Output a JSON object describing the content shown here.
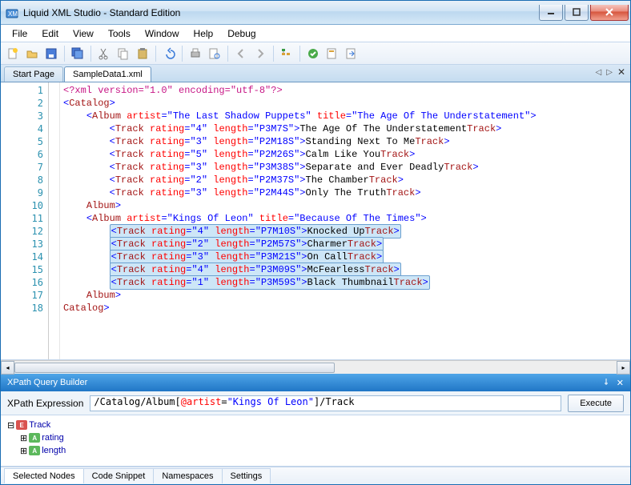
{
  "window": {
    "title": "Liquid XML Studio - Standard Edition"
  },
  "menu": {
    "file": "File",
    "edit": "Edit",
    "view": "View",
    "tools": "Tools",
    "window": "Window",
    "help": "Help",
    "debug": "Debug"
  },
  "tabs": {
    "start": "Start Page",
    "file": "SampleData1.xml"
  },
  "lines": {
    "n1": "1",
    "n2": "2",
    "n3": "3",
    "n4": "4",
    "n5": "5",
    "n6": "6",
    "n7": "7",
    "n8": "8",
    "n9": "9",
    "n10": "10",
    "n11": "11",
    "n12": "12",
    "n13": "13",
    "n14": "14",
    "n15": "15",
    "n16": "16",
    "n17": "17",
    "n18": "18"
  },
  "xml": {
    "decl": "<?xml version=\"1.0\" encoding=\"utf-8\"?>",
    "catalog_open": "Catalog",
    "catalog_close": "Catalog",
    "album1": {
      "tag": "Album",
      "close": "Album",
      "artist_k": "artist",
      "artist_v": "\"The Last Shadow Puppets\"",
      "title_k": "title",
      "title_v": "\"The Age Of The Understatement\"",
      "tracks": [
        {
          "rating": "\"4\"",
          "length": "\"P3M7S\"",
          "text": "The Age Of The Understatement"
        },
        {
          "rating": "\"3\"",
          "length": "\"P2M18S\"",
          "text": "Standing Next To Me"
        },
        {
          "rating": "\"5\"",
          "length": "\"P2M26S\"",
          "text": "Calm Like You"
        },
        {
          "rating": "\"3\"",
          "length": "\"P3M38S\"",
          "text": "Separate and Ever Deadly"
        },
        {
          "rating": "\"2\"",
          "length": "\"P2M37S\"",
          "text": "The Chamber"
        },
        {
          "rating": "\"3\"",
          "length": "\"P2M44S\"",
          "text": "Only The Truth"
        }
      ]
    },
    "album2": {
      "tag": "Album",
      "close": "Album",
      "artist_k": "artist",
      "artist_v": "\"Kings Of Leon\"",
      "title_k": "title",
      "title_v": "\"Because Of The Times\"",
      "tracks": [
        {
          "rating": "\"4\"",
          "length": "\"P7M10S\"",
          "text": "Knocked Up"
        },
        {
          "rating": "\"2\"",
          "length": "\"P2M57S\"",
          "text": "Charmer"
        },
        {
          "rating": "\"3\"",
          "length": "\"P3M21S\"",
          "text": "On Call"
        },
        {
          "rating": "\"4\"",
          "length": "\"P3M09S\"",
          "text": "McFearless"
        },
        {
          "rating": "\"1\"",
          "length": "\"P3M59S\"",
          "text": "Black Thumbnail"
        }
      ]
    },
    "kw": {
      "track": "Track",
      "rating": "rating",
      "length": "length",
      "eq": "=",
      "lt": "<",
      "gt": ">",
      "lts": "</",
      "sp": " "
    }
  },
  "xpath": {
    "panel_title": "XPath Query Builder",
    "label": "XPath Expression",
    "expr_plain": "/Catalog/Album[",
    "expr_attr": "@artist",
    "expr_mid": "=",
    "expr_val": "\"Kings Of Leon\"",
    "expr_tail": "]/Track",
    "execute": "Execute"
  },
  "results": {
    "root": "Track",
    "attr1": "rating",
    "attr2": "length"
  },
  "bottom_tabs": {
    "selected": "Selected Nodes",
    "snippet": "Code Snippet",
    "ns": "Namespaces",
    "settings": "Settings"
  }
}
